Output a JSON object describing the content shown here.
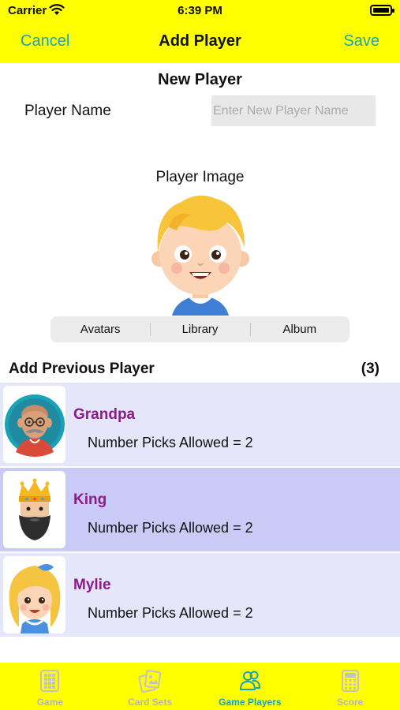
{
  "status_bar": {
    "carrier": "Carrier",
    "time": "6:39 PM"
  },
  "nav": {
    "cancel_label": "Cancel",
    "title": "Add Player",
    "save_label": "Save"
  },
  "new_player": {
    "section_title": "New Player",
    "name_label": "Player Name",
    "name_value": "",
    "name_placeholder": "Enter New Player Name",
    "image_label": "Player Image",
    "image_icon": "boy-avatar"
  },
  "image_source": {
    "options": [
      "Avatars",
      "Library",
      "Album"
    ]
  },
  "previous_players": {
    "header": "Add Previous Player",
    "count": "(3)",
    "items": [
      {
        "name": "Grandpa",
        "picks": "Number Picks Allowed = 2",
        "icon": "grandpa-avatar",
        "selected": false
      },
      {
        "name": "King",
        "picks": "Number Picks Allowed = 2",
        "icon": "king-avatar",
        "selected": true
      },
      {
        "name": "Mylie",
        "picks": "Number Picks Allowed = 2",
        "icon": "girl-avatar",
        "selected": false
      }
    ]
  },
  "tab_bar": {
    "tabs": [
      {
        "label": "Game",
        "icon": "grid-icon",
        "active": false
      },
      {
        "label": "Card Sets",
        "icon": "cards-icon",
        "active": false
      },
      {
        "label": "Game Players",
        "icon": "players-icon",
        "active": true
      },
      {
        "label": "Score",
        "icon": "calculator-icon",
        "active": false
      }
    ]
  },
  "colors": {
    "bar_background": "#ffff00",
    "accent": "#1aa3b8",
    "row_background": "#e6e6fa",
    "row_selected": "#cacaf7",
    "player_name": "#8b1a8b"
  }
}
